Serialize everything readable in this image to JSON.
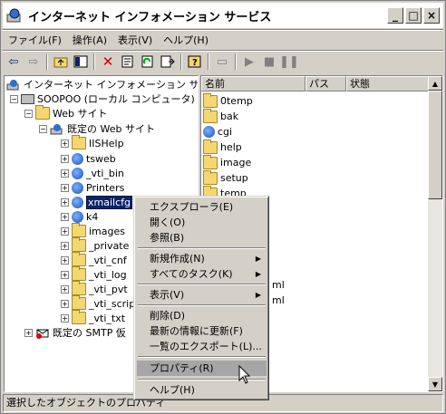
{
  "window": {
    "title": "インターネット インフォメーション サービス",
    "controls": [
      "_",
      "□",
      "×"
    ]
  },
  "menubar": [
    "ファイル(F)",
    "操作(A)",
    "表示(V)",
    "ヘルプ(H)"
  ],
  "tree": {
    "root": "インターネット インフォメーション サービス",
    "computer": "SOOPOO (ローカル コンピュータ)",
    "web_sites": "Web サイト",
    "default_site": "既定の Web サイト",
    "children": [
      "IISHelp",
      "tsweb",
      "_vti_bin",
      "Printers",
      "xmailcfg",
      "k4",
      "images",
      "_private",
      "_vti_cnf",
      "_vti_log",
      "_vti_pvt",
      "_vti_script",
      "_vti_txt"
    ],
    "smtp": "既定の SMTP 仮"
  },
  "list": {
    "columns": [
      "名前",
      "パス",
      "状態"
    ],
    "rows": [
      "0temp",
      "bak",
      "cgi",
      "help",
      "image",
      "setup",
      "temp"
    ],
    "partial_rows": [
      "ml",
      "ml"
    ]
  },
  "context_menu": {
    "items": [
      {
        "label": "エクスプローラ(E)"
      },
      {
        "label": "開く(O)"
      },
      {
        "label": "参照(B)"
      },
      {
        "label": "新規作成(N)",
        "submenu": true
      },
      {
        "label": "すべてのタスク(K)",
        "submenu": true
      },
      {
        "label": "表示(V)",
        "submenu": true
      },
      {
        "label": "削除(D)"
      },
      {
        "label": "最新の情報に更新(F)"
      },
      {
        "label": "一覧のエクスポート(L)..."
      },
      {
        "label": "プロパティ(R)",
        "highlighted": true
      },
      {
        "label": "ヘルプ(H)"
      }
    ]
  },
  "statusbar": "選択したオブジェクトのプロパティ"
}
